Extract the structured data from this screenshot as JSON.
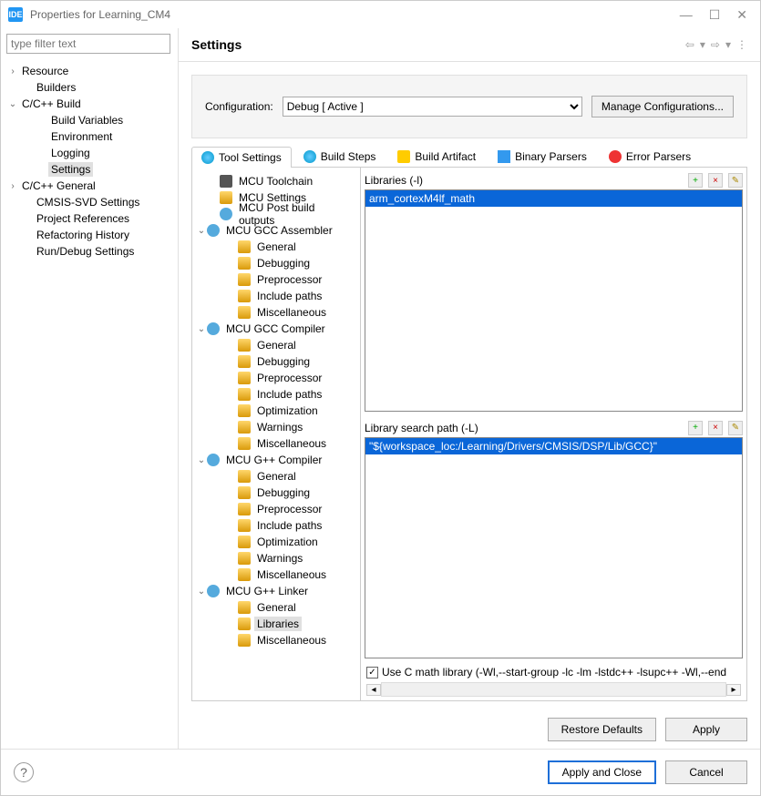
{
  "window": {
    "logo": "IDE",
    "title": "Properties for Learning_CM4",
    "minimize": "—",
    "maximize": "☐",
    "close": "✕"
  },
  "filter": {
    "placeholder": "type filter text"
  },
  "leftTree": [
    {
      "label": "Resource",
      "indent": 0,
      "arrow": "›"
    },
    {
      "label": "Builders",
      "indent": 1,
      "arrow": ""
    },
    {
      "label": "C/C++ Build",
      "indent": 0,
      "arrow": "⌄"
    },
    {
      "label": "Build Variables",
      "indent": 2,
      "arrow": ""
    },
    {
      "label": "Environment",
      "indent": 2,
      "arrow": ""
    },
    {
      "label": "Logging",
      "indent": 2,
      "arrow": ""
    },
    {
      "label": "Settings",
      "indent": 2,
      "arrow": "",
      "selected": true
    },
    {
      "label": "C/C++ General",
      "indent": 0,
      "arrow": "›"
    },
    {
      "label": "CMSIS-SVD Settings",
      "indent": 1,
      "arrow": ""
    },
    {
      "label": "Project References",
      "indent": 1,
      "arrow": ""
    },
    {
      "label": "Refactoring History",
      "indent": 1,
      "arrow": ""
    },
    {
      "label": "Run/Debug Settings",
      "indent": 1,
      "arrow": ""
    }
  ],
  "header": {
    "title": "Settings"
  },
  "config": {
    "label": "Configuration:",
    "value": "Debug  [ Active ]",
    "manageBtn": "Manage Configurations..."
  },
  "tabs": [
    {
      "label": "Tool Settings",
      "iconClass": "ti-blue",
      "active": true
    },
    {
      "label": "Build Steps",
      "iconClass": "ti-blue"
    },
    {
      "label": "Build Artifact",
      "iconClass": "ti-yell"
    },
    {
      "label": "Binary Parsers",
      "iconClass": "ti-bin"
    },
    {
      "label": "Error Parsers",
      "iconClass": "ti-red"
    }
  ],
  "settingsTree": [
    {
      "label": "MCU Toolchain",
      "icon": "ic-chip",
      "indent": "st-i2"
    },
    {
      "label": "MCU Settings",
      "icon": "ic-fold",
      "indent": "st-i2"
    },
    {
      "label": "MCU Post build outputs",
      "icon": "ic-tool",
      "indent": "st-i2"
    },
    {
      "label": "MCU GCC Assembler",
      "icon": "ic-tool",
      "indent": "st-i1",
      "arrow": "⌄"
    },
    {
      "label": "General",
      "icon": "ic-fold",
      "indent": "st-i3"
    },
    {
      "label": "Debugging",
      "icon": "ic-fold",
      "indent": "st-i3"
    },
    {
      "label": "Preprocessor",
      "icon": "ic-fold",
      "indent": "st-i3"
    },
    {
      "label": "Include paths",
      "icon": "ic-fold",
      "indent": "st-i3"
    },
    {
      "label": "Miscellaneous",
      "icon": "ic-fold",
      "indent": "st-i3"
    },
    {
      "label": "MCU GCC Compiler",
      "icon": "ic-tool",
      "indent": "st-i1",
      "arrow": "⌄"
    },
    {
      "label": "General",
      "icon": "ic-fold",
      "indent": "st-i3"
    },
    {
      "label": "Debugging",
      "icon": "ic-fold",
      "indent": "st-i3"
    },
    {
      "label": "Preprocessor",
      "icon": "ic-fold",
      "indent": "st-i3"
    },
    {
      "label": "Include paths",
      "icon": "ic-fold",
      "indent": "st-i3"
    },
    {
      "label": "Optimization",
      "icon": "ic-fold",
      "indent": "st-i3"
    },
    {
      "label": "Warnings",
      "icon": "ic-fold",
      "indent": "st-i3"
    },
    {
      "label": "Miscellaneous",
      "icon": "ic-fold",
      "indent": "st-i3"
    },
    {
      "label": "MCU G++ Compiler",
      "icon": "ic-tool",
      "indent": "st-i1",
      "arrow": "⌄"
    },
    {
      "label": "General",
      "icon": "ic-fold",
      "indent": "st-i3"
    },
    {
      "label": "Debugging",
      "icon": "ic-fold",
      "indent": "st-i3"
    },
    {
      "label": "Preprocessor",
      "icon": "ic-fold",
      "indent": "st-i3"
    },
    {
      "label": "Include paths",
      "icon": "ic-fold",
      "indent": "st-i3"
    },
    {
      "label": "Optimization",
      "icon": "ic-fold",
      "indent": "st-i3"
    },
    {
      "label": "Warnings",
      "icon": "ic-fold",
      "indent": "st-i3"
    },
    {
      "label": "Miscellaneous",
      "icon": "ic-fold",
      "indent": "st-i3"
    },
    {
      "label": "MCU G++ Linker",
      "icon": "ic-tool",
      "indent": "st-i1",
      "arrow": "⌄"
    },
    {
      "label": "General",
      "icon": "ic-fold",
      "indent": "st-i3"
    },
    {
      "label": "Libraries",
      "icon": "ic-fold",
      "indent": "st-i3",
      "selected": true
    },
    {
      "label": "Miscellaneous",
      "icon": "ic-fold",
      "indent": "st-i3"
    }
  ],
  "libPanel": {
    "label": "Libraries (-l)",
    "items": [
      "arm_cortexM4lf_math"
    ]
  },
  "pathPanel": {
    "label": "Library search path (-L)",
    "items": [
      "\"${workspace_loc:/Learning/Drivers/CMSIS/DSP/Lib/GCC}\""
    ]
  },
  "checkLabel": "Use C math library (-Wl,--start-group -lc -lm -lstdc++ -lsupc++ -Wl,--end",
  "footer": {
    "restore": "Restore Defaults",
    "apply": "Apply",
    "applyClose": "Apply and Close",
    "cancel": "Cancel"
  }
}
